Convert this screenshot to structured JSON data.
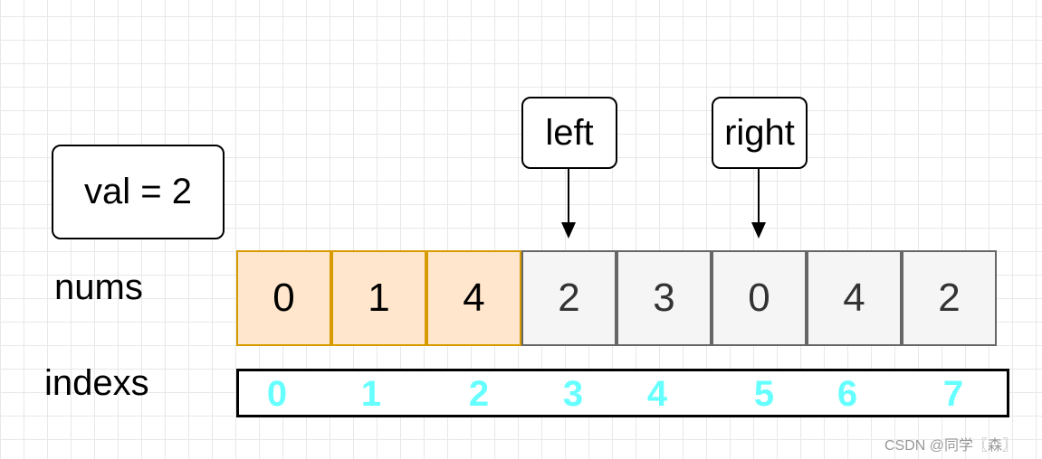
{
  "val_label": "val = 2",
  "pointers": {
    "left": "left",
    "right": "right"
  },
  "row_labels": {
    "nums": "nums",
    "indexs": "indexs"
  },
  "nums": [
    "0",
    "1",
    "4",
    "2",
    "3",
    "0",
    "4",
    "2"
  ],
  "highlighted_count": 3,
  "indexes": [
    "0",
    "1",
    "2",
    "3",
    "4",
    "5",
    "6",
    "7"
  ],
  "colors": {
    "highlight_fill": "#ffe6cc",
    "highlight_stroke": "#d79b00",
    "normal_fill": "#f5f5f5",
    "normal_stroke": "#666666",
    "index_text": "#66ffff"
  },
  "watermark": "CSDN @同学〖森〗"
}
